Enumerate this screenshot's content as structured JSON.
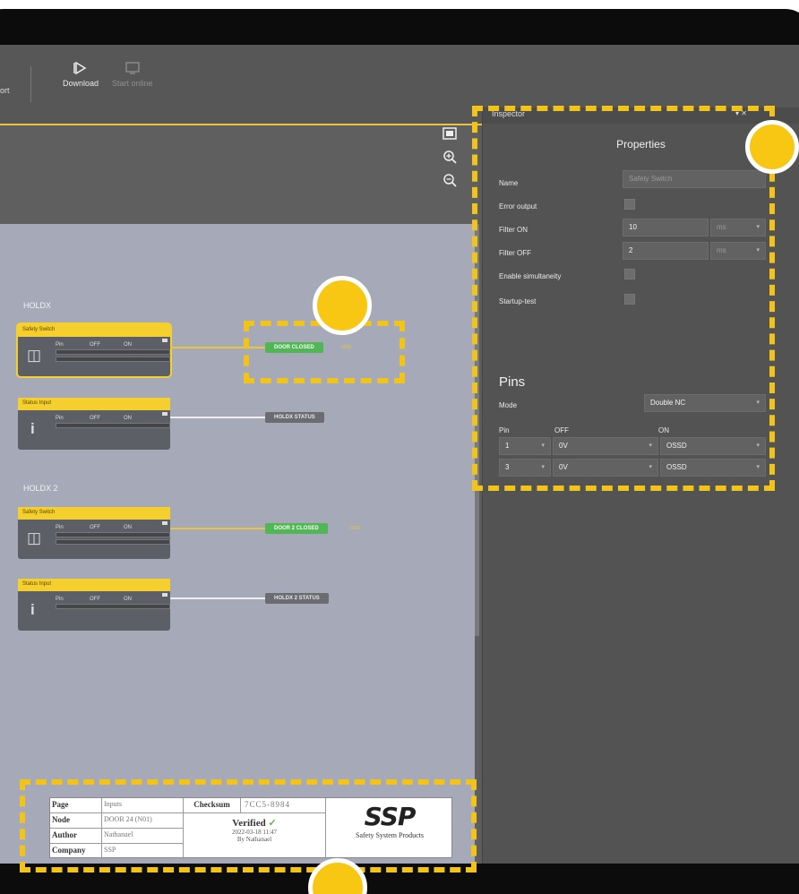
{
  "toolbar": {
    "left_label": "ort",
    "download_label": "Download",
    "start_online_label": "Start online"
  },
  "canvas": {
    "groups": [
      {
        "label": "HOLDX",
        "blocks": [
          {
            "title": "Safety Switch",
            "pin_hdr": "Pin",
            "off_hdr": "OFF",
            "on_hdr": "ON",
            "output_tag": "DOOR CLOSED",
            "tag_note": "- 0000"
          },
          {
            "title": "Status Input",
            "pin_hdr": "Pin",
            "off_hdr": "OFF",
            "on_hdr": "ON",
            "output_tag": "HOLDX STATUS"
          }
        ]
      },
      {
        "label": "HOLDX 2",
        "blocks": [
          {
            "title": "Safety Switch",
            "pin_hdr": "Pin",
            "off_hdr": "OFF",
            "on_hdr": "ON",
            "output_tag": "DOOR 2 CLOSED",
            "tag_note": "- 0000"
          },
          {
            "title": "Status Input",
            "pin_hdr": "Pin",
            "off_hdr": "OFF",
            "on_hdr": "ON",
            "output_tag": "HOLDX 2 STATUS"
          }
        ]
      }
    ]
  },
  "title_block": {
    "page_key": "Page",
    "page_val": "Inputs",
    "node_key": "Node",
    "node_val": "DOOR 24 (N01)",
    "author_key": "Author",
    "author_val": "Nathanael",
    "company_key": "Company",
    "company_val": "SSP",
    "checksum_key": "Checksum",
    "checksum_val": "7CC5-8984",
    "verified_label": "Verified",
    "verified_date": "2022-03-18 11:47",
    "verified_by": "By Nathanael",
    "logo_text": "SSP",
    "logo_sub": "Safety System Products"
  },
  "inspector": {
    "panel_title": "Inspector",
    "pin_ctrl": "▾ ✕",
    "properties_title": "Properties",
    "name_label": "Name",
    "name_placeholder": "Safety Switch",
    "error_output_label": "Error output",
    "filter_on_label": "Filter ON",
    "filter_on_value": "10",
    "filter_on_unit": "ms",
    "filter_off_label": "Filter OFF",
    "filter_off_value": "2",
    "filter_off_unit": "ms",
    "simultaneity_label": "Enable simultaneity",
    "startup_label": "Startup-test",
    "pins_title": "Pins",
    "mode_label": "Mode",
    "mode_value": "Double NC",
    "col_pin": "Pin",
    "col_off": "OFF",
    "col_on": "ON",
    "pin_rows": [
      {
        "pin": "1",
        "off": "0V",
        "on": "OSSD"
      },
      {
        "pin": "3",
        "off": "0V",
        "on": "OSSD"
      }
    ]
  },
  "colors": {
    "accent": "#f4cf2e",
    "highlight": "#f2c318",
    "tag_green": "#52b556"
  }
}
